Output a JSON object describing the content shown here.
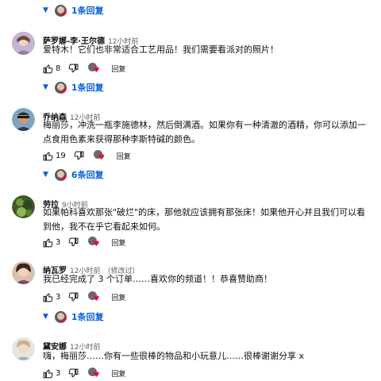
{
  "colors": {
    "link": "#065fd4",
    "heart": "#e3112b",
    "meta": "#606060"
  },
  "top_thread": {
    "label": "1条回复"
  },
  "comments": [
    {
      "author": "萨罗娜-李·王尔德",
      "time": "12小时前",
      "text": "爱特木！它们也非常适合工艺用品！我们需要看派对的照片！",
      "likes": "8",
      "reply": "回复",
      "thread": "1条回复"
    },
    {
      "author": "乔纳森",
      "time": "12小时前",
      "text": "梅丽莎，冲洗一瓶李施德林，然后倒满酒。如果你有一种清澈的酒精，你可以添加一点食用色素来获得那种李斯特碱的颜色。",
      "likes": "19",
      "reply": "回复",
      "thread": "6条回复"
    },
    {
      "author": "劳拉",
      "time": "9小时前",
      "text": "如果帕科喜欢那张\"破烂\"的床，那他就应该拥有那张床！如果他开心并且我们可以看到他，我不在乎它看起来如何。",
      "likes": "3",
      "reply": "回复",
      "thread": ""
    },
    {
      "author": "纳瓦罗",
      "time": "12小时前",
      "edited": "（修改过）",
      "text": "我已经完成了 3 个订单……喜欢你的频道！！恭喜赞助商！",
      "likes": "3",
      "reply": "回复",
      "thread": "1条回复"
    },
    {
      "author": "黛安娜",
      "time": "12小时前",
      "text": "嗨，梅丽莎……你有一些很棒的物品和小玩意儿……很棒谢谢分享 x",
      "likes": "3",
      "reply": "回复",
      "thread": ""
    }
  ]
}
